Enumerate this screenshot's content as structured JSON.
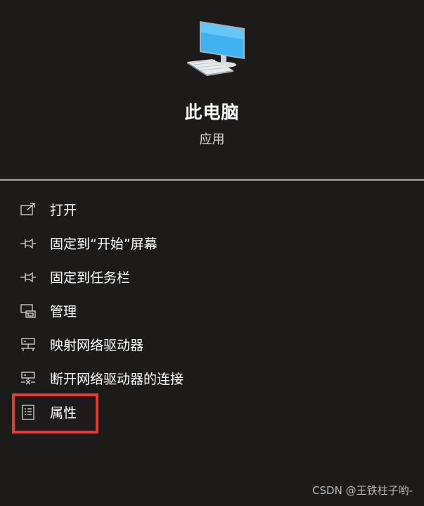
{
  "app": {
    "title": "此电脑",
    "subtitle": "应用",
    "icon": "computer-monitor-icon"
  },
  "menu": {
    "items": [
      {
        "label": "打开",
        "icon": "open-external-icon"
      },
      {
        "label": "固定到“开始”屏幕",
        "icon": "pin-icon"
      },
      {
        "label": "固定到任务栏",
        "icon": "pin-icon"
      },
      {
        "label": "管理",
        "icon": "computer-manage-icon"
      },
      {
        "label": "映射网络驱动器",
        "icon": "network-drive-icon"
      },
      {
        "label": "断开网络驱动器的连接",
        "icon": "network-drive-disconnect-icon"
      },
      {
        "label": "属性",
        "icon": "properties-list-icon"
      }
    ],
    "highlighted_index": 6
  },
  "watermark": "CSDN @王铁柱子哟-",
  "colors": {
    "background": "#1d1b1a",
    "divider": "#8b8b8b",
    "highlight": "#e33a3a",
    "icon_stroke": "#d8d8d8",
    "monitor_blue": "#3fb2ef"
  }
}
